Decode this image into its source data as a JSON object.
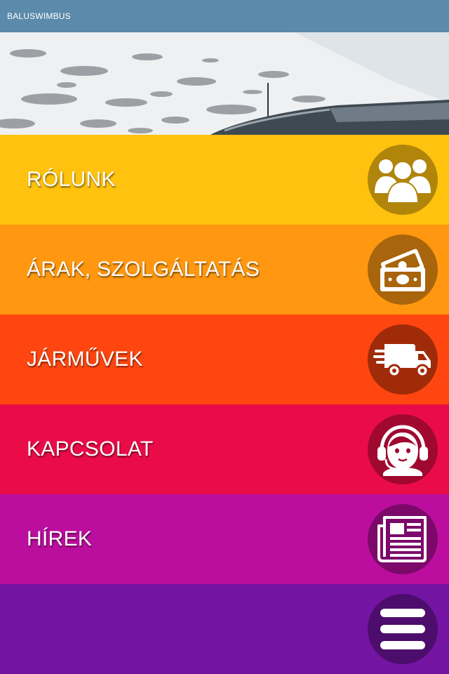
{
  "header": {
    "title": "BALUSWIMBUS"
  },
  "menu": {
    "items": [
      {
        "label": "RÓLUNK",
        "icon": "users-icon",
        "bg": "#ffc20e",
        "circle": "#b0850a"
      },
      {
        "label": "ÁRAK, SZOLGÁLTATÁS",
        "icon": "money-icon",
        "bg": "#ff9810",
        "circle": "#a8650c"
      },
      {
        "label": "JÁRMŰVEK",
        "icon": "delivery-truck-icon",
        "bg": "#ff4610",
        "circle": "#a02b08"
      },
      {
        "label": "KAPCSOLAT",
        "icon": "support-agent-icon",
        "bg": "#ea0c48",
        "circle": "#a00830"
      },
      {
        "label": "HÍREK",
        "icon": "newspaper-icon",
        "bg": "#bb0e9e",
        "circle": "#7c0969"
      },
      {
        "label": "",
        "icon": "hamburger-menu-icon",
        "bg": "#7414a2",
        "circle": "#4c0d6d"
      }
    ]
  }
}
